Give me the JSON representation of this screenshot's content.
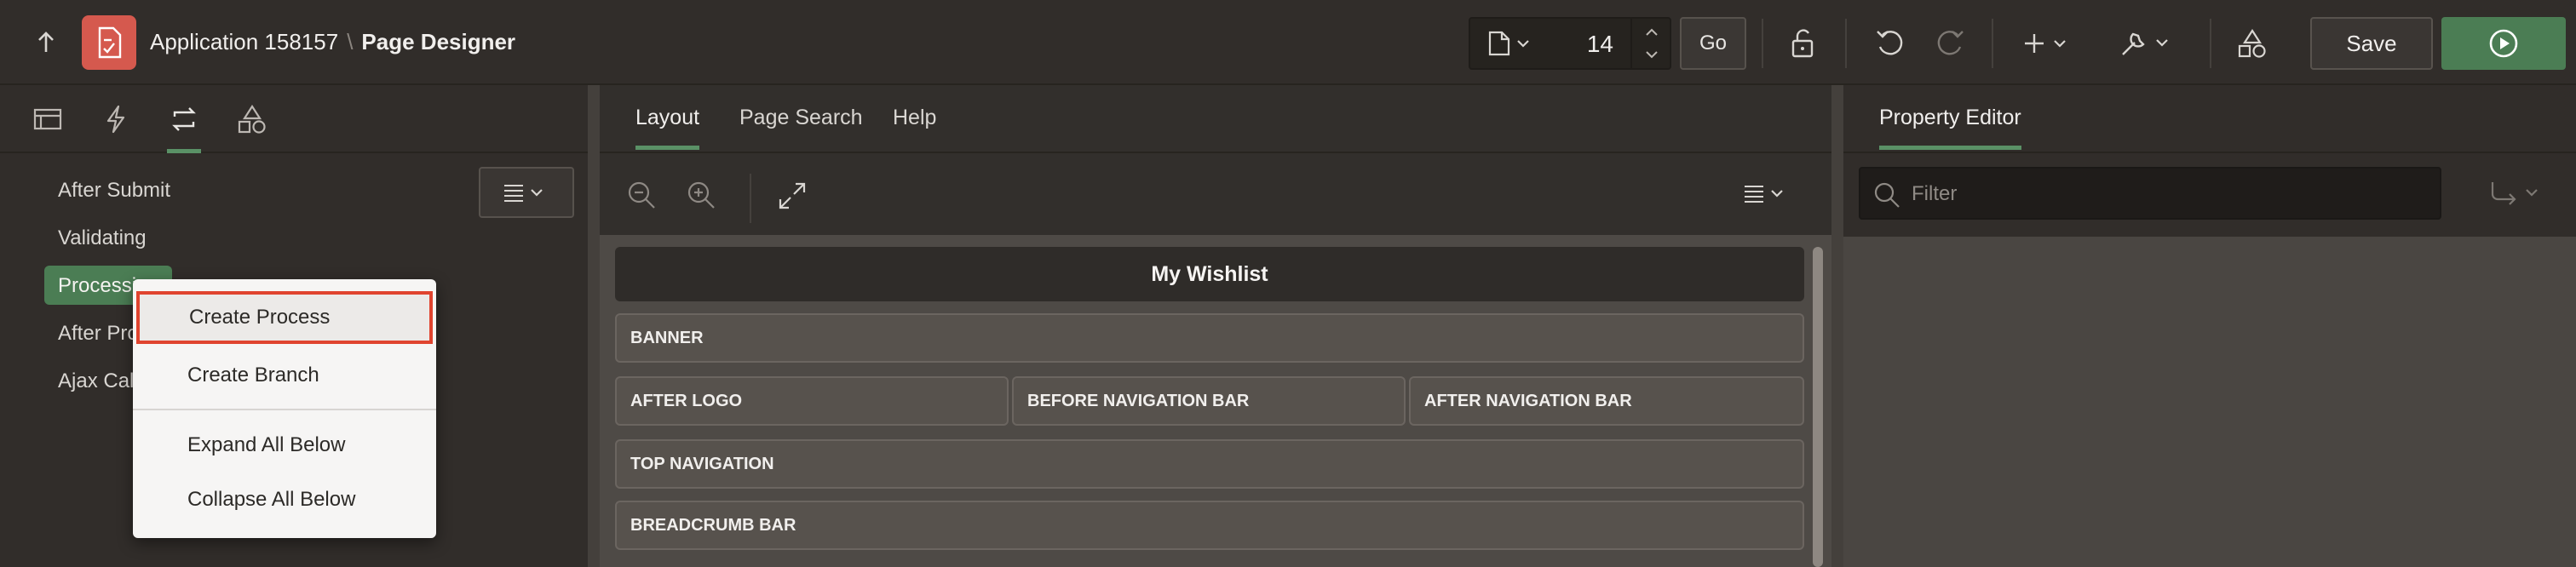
{
  "header": {
    "app_name": "Application 158157",
    "separator": "\\",
    "page_title": "Page Designer",
    "page_number": "14",
    "go_label": "Go",
    "save_label": "Save"
  },
  "left_panel": {
    "tabs": [
      "rendering-icon",
      "dynamic-actions-icon",
      "processing-icon",
      "shared-components-icon"
    ],
    "tree_items": [
      "After Submit",
      "Validating",
      "Processing",
      "After Processing",
      "Ajax Callback"
    ],
    "tree_items_visible": [
      "After Submit",
      "Validating",
      "Processi",
      "After Pro",
      "Ajax Cal"
    ],
    "selected_item": "Processing"
  },
  "context_menu": {
    "items": [
      "Create Process",
      "Create Branch",
      "Expand All Below",
      "Collapse All Below"
    ],
    "highlighted": "Create Process"
  },
  "center_panel": {
    "tabs": [
      "Layout",
      "Page Search",
      "Help"
    ],
    "active_tab": "Layout",
    "page_name": "My Wishlist",
    "regions": {
      "banner": "BANNER",
      "after_logo": "AFTER LOGO",
      "before_nav": "BEFORE NAVIGATION BAR",
      "after_nav": "AFTER NAVIGATION BAR",
      "top_nav": "TOP NAVIGATION",
      "breadcrumb": "BREADCRUMB BAR"
    }
  },
  "right_panel": {
    "tab": "Property Editor",
    "filter_placeholder": "Filter"
  },
  "colors": {
    "accent_green": "#4b7d54",
    "app_icon_red": "#d5594e",
    "highlight_border": "#e0442f"
  }
}
